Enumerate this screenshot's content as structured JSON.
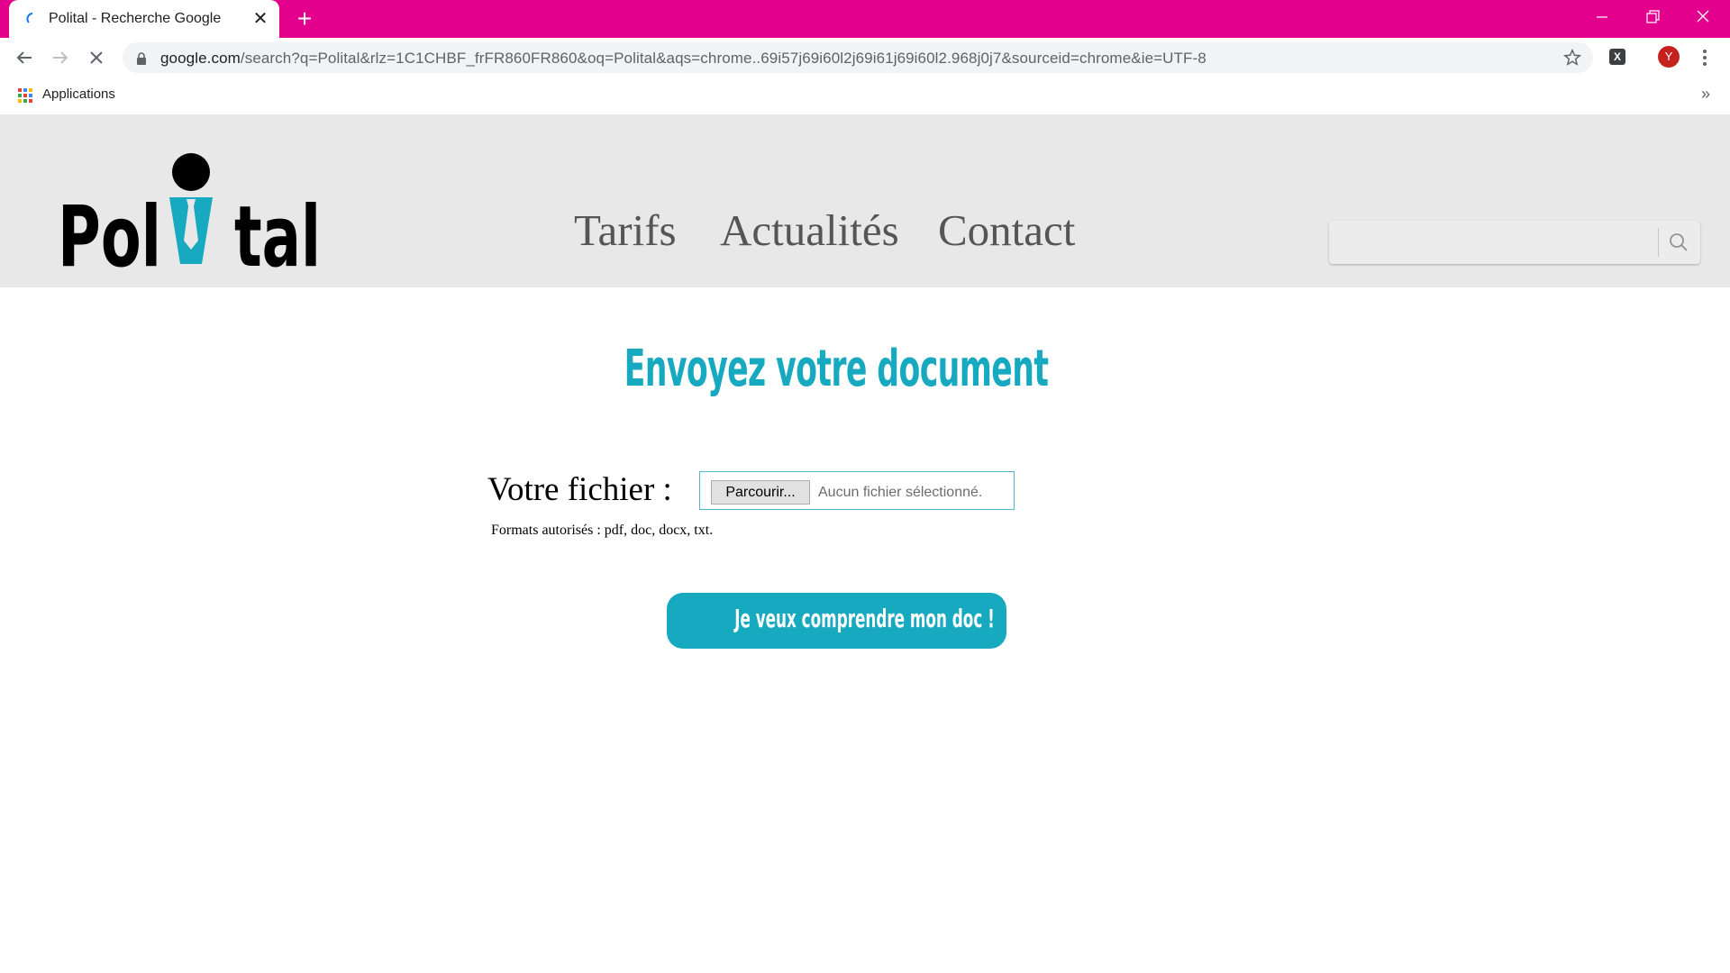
{
  "browser": {
    "tab": {
      "title": "Polital - Recherche Google",
      "close_label": "✕"
    },
    "new_tab_label": "+",
    "address": {
      "domain": "google.com",
      "path": "/search?q=Polital&rlz=1C1CHBF_frFR860FR860&oq=Polital&aqs=chrome..69i57j69i60l2j69i61j69i60l2.968j0j7&sourceid=chrome&ie=UTF-8"
    },
    "profile_initial": "Y",
    "extension_label": "X",
    "bookmarks": {
      "apps_label": "Applications",
      "more_label": "»"
    }
  },
  "site": {
    "logo_text": {
      "left": "Pol",
      "right": "tal"
    },
    "nav": [
      "Tarifs",
      "Actualités",
      "Contact"
    ],
    "search": {
      "placeholder": "",
      "value": ""
    }
  },
  "upload": {
    "heading": "Envoyez votre document",
    "file_label": "Votre fichier :",
    "browse_label": "Parcourir...",
    "no_file_text": "Aucun fichier sélectionné.",
    "formats_text": "Formats autorisés : pdf, doc, docx, txt.",
    "submit_label": "Je veux comprendre mon doc !"
  },
  "colors": {
    "titlebar": "#e3008c",
    "accent": "#17a9bf",
    "header_bg": "#e8e8e8"
  }
}
